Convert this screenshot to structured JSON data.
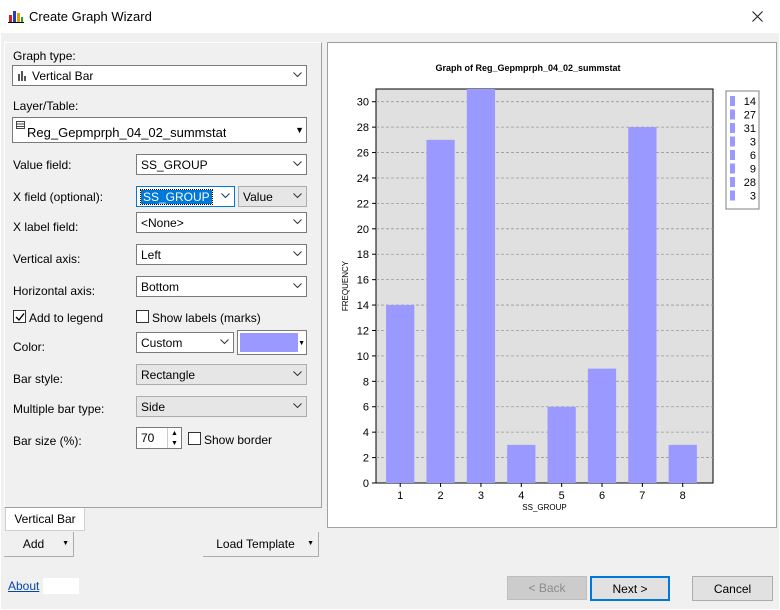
{
  "window": {
    "title": "Create Graph Wizard"
  },
  "form": {
    "graph_type_label": "Graph type:",
    "graph_type_value": "Vertical Bar",
    "layer_label": "Layer/Table:",
    "layer_value": "Reg_Gepmprph_04_02_summstat",
    "value_field_label": "Value field:",
    "value_field_value": "SS_GROUP",
    "x_field_label": "X field (optional):",
    "x_field_value": "SS_GROUP",
    "x_field_mode": "Value",
    "x_label_field_label": "X label field:",
    "x_label_field_value": "<None>",
    "vertical_axis_label": "Vertical axis:",
    "vertical_axis_value": "Left",
    "horizontal_axis_label": "Horizontal axis:",
    "horizontal_axis_value": "Bottom",
    "add_to_legend_label": "Add to legend",
    "add_to_legend_checked": true,
    "show_labels_label": "Show labels (marks)",
    "show_labels_checked": false,
    "color_label": "Color:",
    "color_value": "Custom",
    "color_swatch": "#9999ff",
    "bar_style_label": "Bar style:",
    "bar_style_value": "Rectangle",
    "multiple_bar_label": "Multiple bar type:",
    "multiple_bar_value": "Side",
    "bar_size_label": "Bar size (%):",
    "bar_size_value": "70",
    "show_border_label": "Show border",
    "show_border_checked": false
  },
  "tabs": {
    "vertical_bar": "Vertical Bar"
  },
  "buttons": {
    "add": "Add",
    "load_template": "Load Template",
    "back": "< Back",
    "next": "Next >",
    "cancel": "Cancel"
  },
  "footer": {
    "about": "About"
  },
  "icons": {
    "app": "graph-wizard-icon",
    "close": "close-icon",
    "bar_chart": "bar-chart-icon",
    "table": "table-icon"
  },
  "chart_data": {
    "type": "bar",
    "title": "Graph of Reg_Gepmprph_04_02_summstat",
    "xlabel": "SS_GROUP",
    "ylabel": "FREQUENCY",
    "categories": [
      "1",
      "2",
      "3",
      "4",
      "5",
      "6",
      "7",
      "8"
    ],
    "values": [
      14,
      27,
      31,
      3,
      6,
      9,
      28,
      3
    ],
    "ylim": [
      0,
      31
    ],
    "yticks": [
      0,
      2,
      4,
      6,
      8,
      10,
      12,
      14,
      16,
      18,
      20,
      22,
      24,
      26,
      28,
      30
    ],
    "grid": true,
    "bar_color": "#9999ff",
    "plot_bg": "#e0e0e0",
    "legend_placement": "right",
    "legend_labels": [
      "14",
      "27",
      "31",
      "3",
      "6",
      "9",
      "28",
      "3"
    ]
  }
}
